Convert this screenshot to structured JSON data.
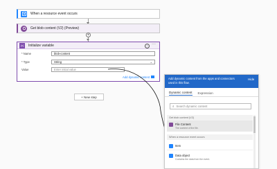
{
  "colors": {
    "event_grid_blue": "#1f85ff",
    "blob_purple": "#804998",
    "variable_purple": "#7e4bad",
    "link_blue": "#1f85ff",
    "panel_header_blue": "#2168c8",
    "selected_bg": "#e8e8e8"
  },
  "steps": {
    "trigger": {
      "title": "When a resource event occurs",
      "icon": "event-grid-icon"
    },
    "blob": {
      "title": "Get blob content (V2) (Preview)",
      "icon": "blob-icon"
    },
    "init_var": {
      "title": "Initialize variable",
      "icon": "variable-icon",
      "name_label": "* Name",
      "name_value": "blob-content",
      "type_label": "* Type",
      "type_value": "String",
      "value_label": "Value",
      "value_placeholder": "Enter initial value",
      "add_dynamic": "Add dynamic content"
    }
  },
  "new_step": "+ New step",
  "panel": {
    "header_text": "Add dynamic content from the apps and connectors used in this flow.",
    "hide_label": "Hide",
    "tabs": [
      "Dynamic content",
      "Expression"
    ],
    "search_placeholder": "Search dynamic content",
    "sections": [
      {
        "title": "Get blob content (V2)",
        "items": [
          {
            "name": "File Content",
            "desc": "The content of the file.",
            "selected": true
          }
        ]
      },
      {
        "title": "When a resource event occurs",
        "items": [
          {
            "name": "Item",
            "desc": ""
          },
          {
            "name": "Data object",
            "desc": "Contains the data from the event."
          }
        ]
      }
    ]
  }
}
